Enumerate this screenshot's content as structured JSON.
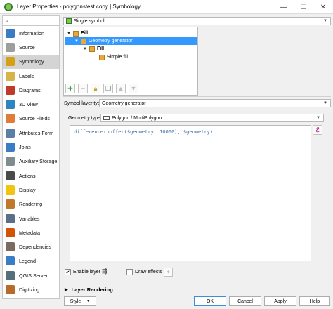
{
  "window": {
    "title": "Layer Properties - polygonstest copy | Symbology",
    "minimize": "—",
    "maximize": "☐",
    "close": "✕"
  },
  "sidebar": {
    "search_icon": "search-icon",
    "items": [
      {
        "label": "Information",
        "icon": "info-icon",
        "color": "#3b7dc4"
      },
      {
        "label": "Source",
        "icon": "source-icon",
        "color": "#9e9e9e"
      },
      {
        "label": "Symbology",
        "icon": "symbology-icon",
        "color": "#d4a017"
      },
      {
        "label": "Labels",
        "icon": "labels-icon",
        "color": "#d7b34b"
      },
      {
        "label": "Diagrams",
        "icon": "diagrams-icon",
        "color": "#c0392b"
      },
      {
        "label": "3D View",
        "icon": "3d-view-icon",
        "color": "#2e86c1"
      },
      {
        "label": "Source Fields",
        "icon": "source-fields-icon",
        "color": "#e07b39"
      },
      {
        "label": "Attributes Form",
        "icon": "attributes-form-icon",
        "color": "#5b7fa6"
      },
      {
        "label": "Joins",
        "icon": "joins-icon",
        "color": "#3b7dc4"
      },
      {
        "label": "Auxiliary Storage",
        "icon": "auxiliary-storage-icon",
        "color": "#7f8c8d"
      },
      {
        "label": "Actions",
        "icon": "actions-icon",
        "color": "#4a4a4a"
      },
      {
        "label": "Display",
        "icon": "display-icon",
        "color": "#f1c40f"
      },
      {
        "label": "Rendering",
        "icon": "rendering-icon",
        "color": "#c0792b"
      },
      {
        "label": "Variables",
        "icon": "variables-icon",
        "color": "#5b6f86"
      },
      {
        "label": "Metadata",
        "icon": "metadata-icon",
        "color": "#d35400"
      },
      {
        "label": "Dependencies",
        "icon": "dependencies-icon",
        "color": "#7a6b5d"
      },
      {
        "label": "Legend",
        "icon": "legend-icon",
        "color": "#3b7dc4"
      },
      {
        "label": "QGIS Server",
        "icon": "qgis-server-icon",
        "color": "#546e7a"
      },
      {
        "label": "Digitizing",
        "icon": "digitizing-icon",
        "color": "#b86a2b"
      }
    ],
    "active_index": 2
  },
  "renderer": {
    "selected": "Single symbol"
  },
  "symbol_tree": {
    "root": "Fill",
    "generator": "Geometry generator",
    "sub": "Fill",
    "leaf": "Simple fill"
  },
  "symbol_layer_type": {
    "label": "Symbol layer type",
    "value": "Geometry generator"
  },
  "geometry_type": {
    "label": "Geometry type",
    "value": "Polygon / MultiPolygon"
  },
  "expression": "difference(buffer($geometry, 10000), $geometry)",
  "enable_layer": {
    "label": "Enable layer",
    "checked": true
  },
  "draw_effects": {
    "label": "Draw effects",
    "checked": false
  },
  "layer_rendering": "Layer Rendering",
  "buttons": {
    "style": "Style",
    "ok": "OK",
    "cancel": "Cancel",
    "apply": "Apply",
    "help": "Help"
  }
}
